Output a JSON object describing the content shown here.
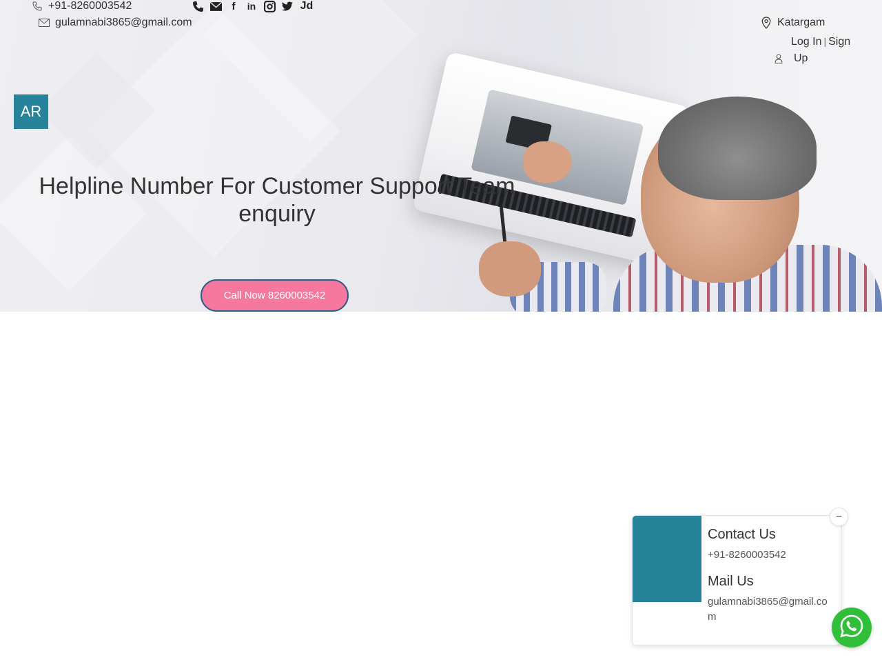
{
  "header": {
    "phone": "+91-8260003542",
    "email": "gulamnabi3865@gmail.com",
    "location": "Katargam",
    "login_label": "Log In",
    "separator": "|",
    "signup_label_part1": "Sign",
    "signup_label_part2": "Up",
    "social_icons": [
      "phone-icon",
      "mail-icon",
      "facebook-icon",
      "linkedin-icon",
      "instagram-icon",
      "twitter-icon",
      "justdial-icon"
    ],
    "social_glyphs": {
      "phone": "✆",
      "mail": "✉",
      "facebook": "f",
      "linkedin": "in",
      "instagram": "◙",
      "twitter": "🐦",
      "justdial": "Jd"
    }
  },
  "logo": {
    "text": "AR",
    "color": "#268399"
  },
  "hero": {
    "title_line1": "Helpline Number For Customer Support Team",
    "title_line2": "enquiry",
    "cta_label": "Call Now 8260003542"
  },
  "contact_card": {
    "contact_heading": "Contact Us",
    "contact_phone": "+91-8260003542",
    "mail_heading": "Mail Us",
    "mail_value": "gulamnabi3865@gmail.com",
    "minimize_glyph": "−"
  },
  "colors": {
    "brand": "#268399",
    "cta": "#f7789e",
    "whatsapp": "#30bf39"
  }
}
